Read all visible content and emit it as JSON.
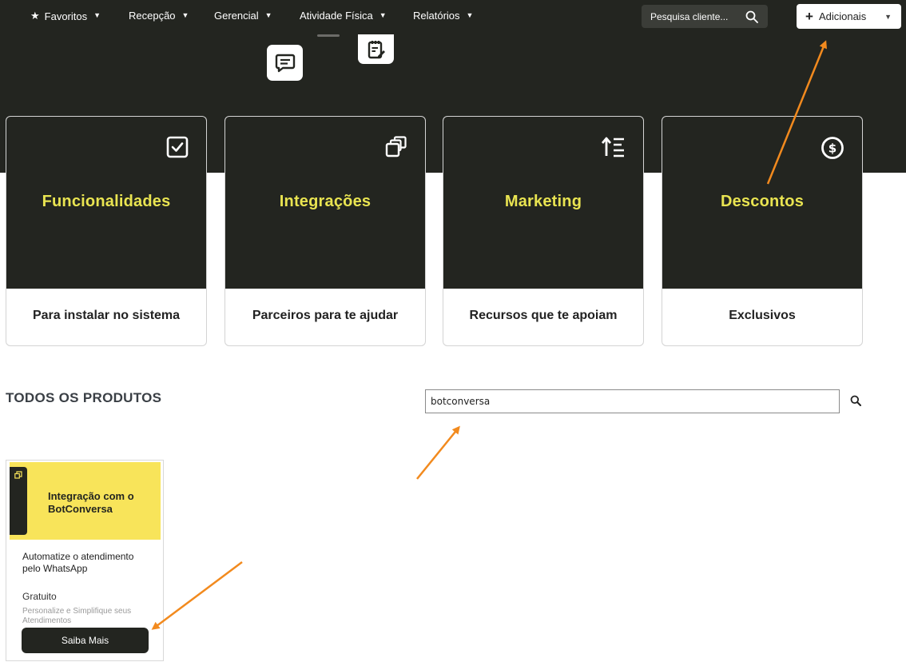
{
  "navbar": {
    "items": [
      {
        "label": "Favoritos",
        "icon": "star-icon"
      },
      {
        "label": "Recepção"
      },
      {
        "label": "Gerencial"
      },
      {
        "label": "Atividade Física"
      },
      {
        "label": "Relatórios"
      }
    ],
    "search_placeholder": "Pesquisa cliente...",
    "add_label": "Adicionais"
  },
  "categories": [
    {
      "title": "Funcionalidades",
      "subtitle": "Para instalar no sistema",
      "icon": "checkbox-icon"
    },
    {
      "title": "Integrações",
      "subtitle": "Parceiros para te ajudar",
      "icon": "copy-icon"
    },
    {
      "title": "Marketing",
      "subtitle": "Recursos que te apoiam",
      "icon": "sort-list-icon"
    },
    {
      "title": "Descontos",
      "subtitle": "Exclusivos",
      "icon": "dollar-circle-icon"
    }
  ],
  "products": {
    "section_title": "TODOS OS PRODUTOS",
    "search_value": "botconversa",
    "items": [
      {
        "banner_title": "Integração com o BotConversa",
        "description": "Automatize o atendimento pelo WhatsApp",
        "price": "Gratuito",
        "tagline": "Personalize e Simplifique seus Atendimentos",
        "button_label": "Saiba Mais"
      }
    ]
  },
  "colors": {
    "dark": "#232520",
    "accent_yellow": "#e9e451",
    "banner_yellow": "#f8e45a",
    "annotation_orange": "#f28a1e"
  }
}
